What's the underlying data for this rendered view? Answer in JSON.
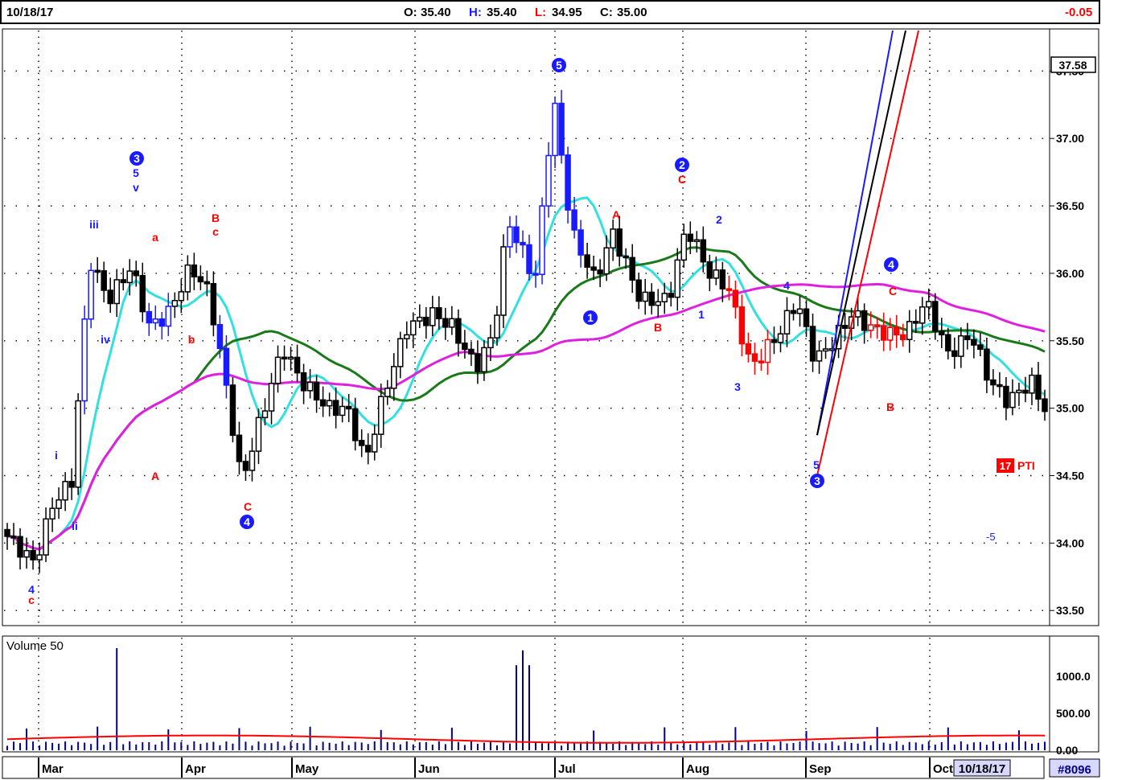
{
  "header": {
    "date": "10/18/17",
    "ohlc": [
      {
        "key": "O:",
        "val": "35.40"
      },
      {
        "key": "H:",
        "val": "35.40"
      },
      {
        "key": "L:",
        "val": "34.95"
      },
      {
        "key": "C:",
        "val": "35.00"
      }
    ],
    "change": "-0.05"
  },
  "chart_data": {
    "type": "candlestick",
    "price_ticks": [
      "37.50",
      "37.00",
      "36.50",
      "36.00",
      "35.50",
      "35.00",
      "34.50",
      "34.00",
      "33.50"
    ],
    "price_ylim": [
      33.4,
      37.8
    ],
    "last_price_label": "37.58",
    "volume_panel_label": "Volume 50",
    "volume_ticks": [
      "1000.0",
      "500.00",
      "0.00"
    ],
    "volume_ylim": [
      0,
      1500
    ],
    "month_labels": [
      "Mar",
      "Apr",
      "May",
      "Jun",
      "Jul",
      "Aug",
      "Sep",
      "Oct"
    ],
    "current_date_label": "10/18/17",
    "symbol_label": "#8096",
    "pti_label": {
      "value": "17",
      "text": "PTI"
    },
    "target_label": "-5",
    "colors": {
      "up_candle": "#1a1aff",
      "down_candle": "#000000",
      "red_candle": "#ff0000",
      "ma_short": "#33e0e0",
      "ma_mid": "#1a7a1a",
      "ma_long": "#e020e0",
      "volume_bar": "#00008b",
      "volume_avg": "#ff0000"
    },
    "wave_labels": [
      {
        "text": "3",
        "circled": true,
        "color": "blue"
      },
      {
        "text": "5",
        "circled": false,
        "color": "blue"
      },
      {
        "text": "v",
        "circled": false,
        "color": "blue"
      },
      {
        "text": "iii",
        "circled": false,
        "color": "blue"
      },
      {
        "text": "iv",
        "circled": false,
        "color": "blue"
      },
      {
        "text": "i",
        "circled": false,
        "color": "blue"
      },
      {
        "text": "ii",
        "circled": false,
        "color": "blue"
      },
      {
        "text": "a",
        "circled": false,
        "color": "red"
      },
      {
        "text": "A",
        "circled": false,
        "color": "red"
      },
      {
        "text": "b",
        "circled": false,
        "color": "red"
      },
      {
        "text": "B",
        "circled": false,
        "color": "red"
      },
      {
        "text": "c",
        "circled": false,
        "color": "red"
      },
      {
        "text": "c",
        "circled": false,
        "color": "red"
      },
      {
        "text": "4",
        "circled": false,
        "color": "blue"
      },
      {
        "text": "C",
        "circled": false,
        "color": "red"
      },
      {
        "text": "4",
        "circled": true,
        "color": "blue"
      },
      {
        "text": "5",
        "circled": true,
        "color": "blue"
      },
      {
        "text": "1",
        "circled": true,
        "color": "blue"
      },
      {
        "text": "A",
        "circled": false,
        "color": "red"
      },
      {
        "text": "B",
        "circled": false,
        "color": "red"
      },
      {
        "text": "2",
        "circled": true,
        "color": "blue"
      },
      {
        "text": "C",
        "circled": false,
        "color": "red"
      },
      {
        "text": "2",
        "circled": false,
        "color": "blue"
      },
      {
        "text": "1",
        "circled": false,
        "color": "blue"
      },
      {
        "text": "3",
        "circled": false,
        "color": "blue"
      },
      {
        "text": "4",
        "circled": false,
        "color": "blue"
      },
      {
        "text": "5",
        "circled": false,
        "color": "blue"
      },
      {
        "text": "3",
        "circled": true,
        "color": "blue"
      },
      {
        "text": "4",
        "circled": true,
        "color": "blue"
      },
      {
        "text": "C",
        "circled": false,
        "color": "red"
      },
      {
        "text": "B",
        "circled": false,
        "color": "red"
      }
    ],
    "note": "Daily candlestick chart with three moving averages, Elliott wave labels, and 50-day volume panel"
  }
}
